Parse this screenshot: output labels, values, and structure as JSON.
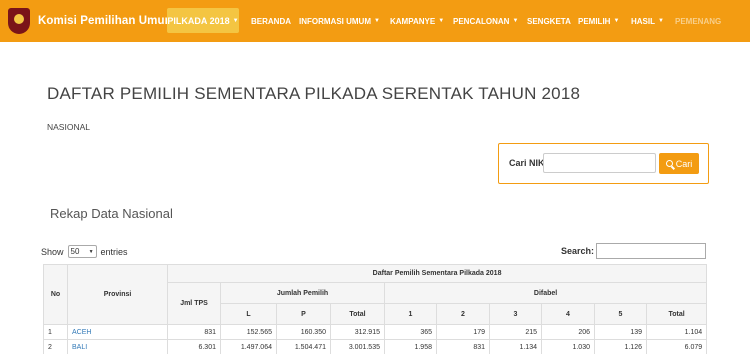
{
  "nav": {
    "brand": "Komisi Pemilihan Umum",
    "pilkada": "PILKADA 2018",
    "items": [
      "BERANDA",
      "INFORMASI UMUM",
      "KAMPANYE",
      "PENCALONAN",
      "SENGKETA",
      "PEMILIH",
      "HASIL",
      "PEMENANG"
    ]
  },
  "page": {
    "title": "DAFTAR PEMILIH SEMENTARA PILKADA SERENTAK TAHUN 2018",
    "subtitle": "NASIONAL",
    "section": "Rekap Data Nasional"
  },
  "nik": {
    "label": "Cari NIK",
    "button": "Cari",
    "value": ""
  },
  "controls": {
    "show": "Show",
    "entries": "entries",
    "page_size": "50",
    "search_label": "Search:",
    "search_value": ""
  },
  "table": {
    "group_header": "Daftar Pemilih Sementara Pilkada 2018",
    "col_no": "No",
    "col_provinsi": "Provinsi",
    "col_tps": "Jml TPS",
    "col_jumlah": "Jumlah Pemilih",
    "col_difabel": "Difabel",
    "sub": {
      "l": "L",
      "p": "P",
      "total": "Total",
      "d1": "1",
      "d2": "2",
      "d3": "3",
      "d4": "4",
      "d5": "5",
      "dtotal": "Total"
    },
    "rows": [
      {
        "no": "1",
        "provinsi": "ACEH",
        "tps": "831",
        "l": "152.565",
        "p": "160.350",
        "total": "312.915",
        "d1": "365",
        "d2": "179",
        "d3": "215",
        "d4": "206",
        "d5": "139",
        "dtotal": "1.104"
      },
      {
        "no": "2",
        "provinsi": "BALI",
        "tps": "6.301",
        "l": "1.497.064",
        "p": "1.504.471",
        "total": "3.001.535",
        "d1": "1.958",
        "d2": "831",
        "d3": "1.134",
        "d4": "1.030",
        "d5": "1.126",
        "dtotal": "6.079"
      }
    ]
  },
  "colors": {
    "accent": "#f39c12",
    "pilkada_button": "#f4c542",
    "link": "#337ab7"
  }
}
